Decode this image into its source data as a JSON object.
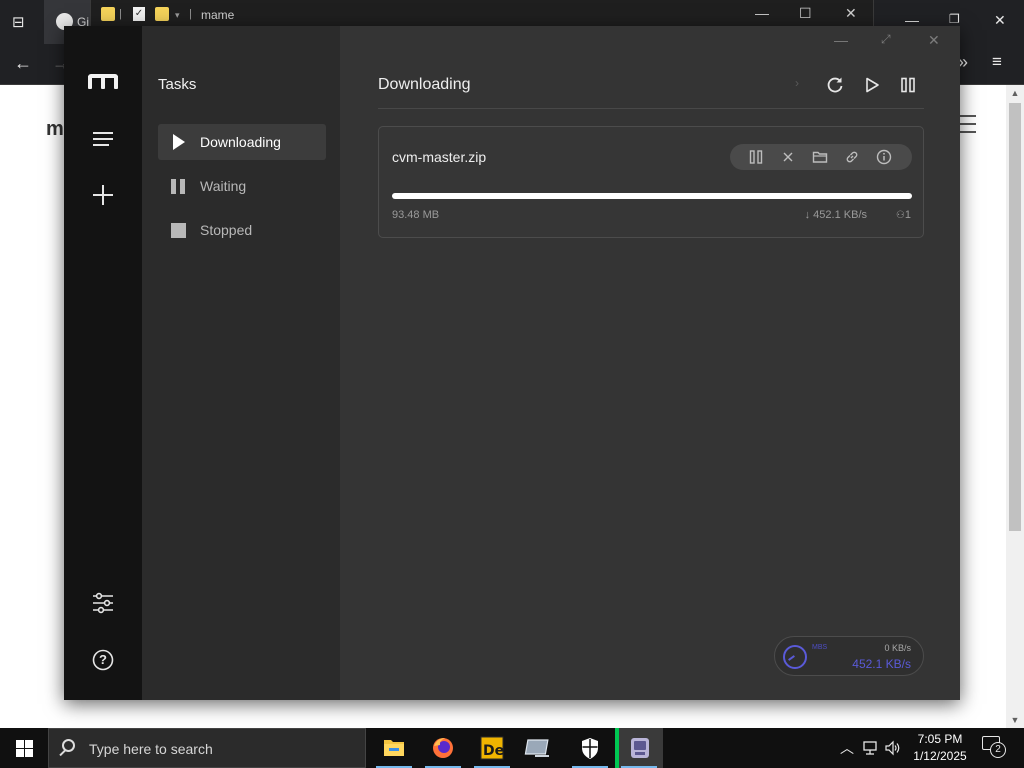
{
  "browser": {
    "tab_label": "Gi",
    "page_fragment": "m"
  },
  "explorer": {
    "title": "mame",
    "controls": {
      "minimize": "—",
      "maximize": "☐",
      "close": "✕"
    }
  },
  "app": {
    "sidebar": {
      "heading": "Tasks",
      "items": [
        {
          "label": "Downloading",
          "icon": "play-icon",
          "active": true
        },
        {
          "label": "Waiting",
          "icon": "pause-icon",
          "active": false
        },
        {
          "label": "Stopped",
          "icon": "stop-icon",
          "active": false
        }
      ]
    },
    "rail": {
      "icons": [
        "motrix-logo",
        "menu-icon",
        "add-task-icon",
        "settings-icon",
        "help-icon"
      ],
      "help_label": "?"
    },
    "main": {
      "title": "Downloading",
      "header_actions": [
        "refresh-icon",
        "resume-all-icon",
        "pause-all-icon"
      ]
    },
    "task": {
      "name": "cvm-master.zip",
      "size": "93.48 MB",
      "speed": "↓ 452.1 KB/s",
      "connections": "1",
      "progress": 1.0,
      "actions": [
        "pause-icon",
        "delete-icon",
        "folder-icon",
        "link-icon",
        "info-icon"
      ]
    },
    "speedometer": {
      "mode_label": "MBS",
      "upload": "0 KB/s",
      "download": "452.1 KB/s"
    },
    "colors": {
      "accent": "#5a5ad8",
      "background": "#343434",
      "rail": "#131313",
      "sidebar": "#2b2b2b"
    }
  },
  "taskbar": {
    "search_placeholder": "Type here to search",
    "time": "7:05 PM",
    "date": "1/12/2025",
    "notification_count": "2",
    "apps": [
      "file-explorer",
      "firefox",
      "deluge",
      "remote-desktop",
      "windows-security",
      "motrix"
    ]
  }
}
